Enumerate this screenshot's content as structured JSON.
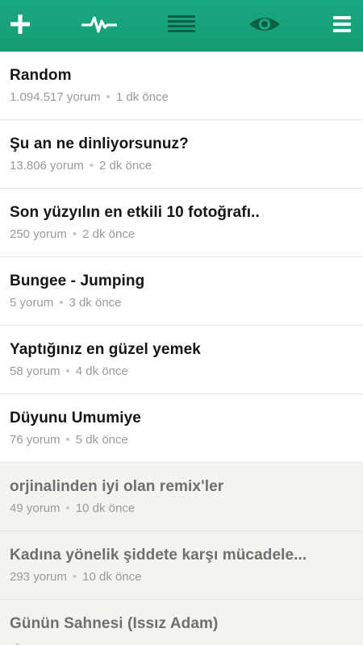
{
  "toolbar": {
    "icons": [
      "plus-icon",
      "pulse-icon",
      "list-icon",
      "eye-icon",
      "menu-icon"
    ],
    "accent_color": "#1aa981",
    "icon_color_light": "#ffffff",
    "icon_color_dark": "#0d5f47"
  },
  "topics": [
    {
      "title": "Random",
      "comments": "1.094.517 yorum",
      "time": "1 dk önce",
      "read": false
    },
    {
      "title": "Şu an ne dinliyorsunuz?",
      "comments": "13.806 yorum",
      "time": "2 dk önce",
      "read": false
    },
    {
      "title": "Son yüzyılın en etkili 10 fotoğrafı..",
      "comments": "250 yorum",
      "time": "2 dk önce",
      "read": false
    },
    {
      "title": "Bungee - Jumping",
      "comments": "5 yorum",
      "time": "3 dk önce",
      "read": false
    },
    {
      "title": "Yaptığınız en güzel yemek",
      "comments": "58 yorum",
      "time": "4 dk önce",
      "read": false
    },
    {
      "title": "Düyunu Umumiye",
      "comments": "76 yorum",
      "time": "5 dk önce",
      "read": false
    },
    {
      "title": "orjinalinden iyi olan remix'ler",
      "comments": "49 yorum",
      "time": "10 dk önce",
      "read": true
    },
    {
      "title": "Kadına yönelik şiddete karşı mücadele...",
      "comments": "293 yorum",
      "time": "10 dk önce",
      "read": true
    },
    {
      "title": "Günün Sahnesi (Issız Adam)",
      "comments": "",
      "time": "",
      "read": true
    }
  ]
}
